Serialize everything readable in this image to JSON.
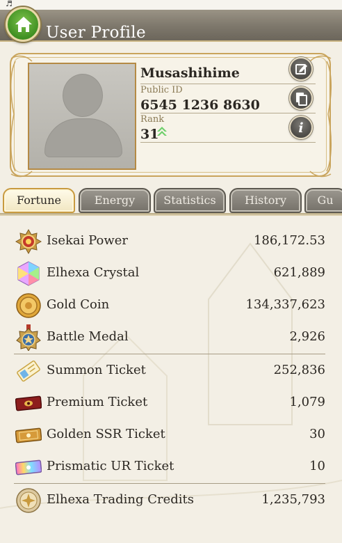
{
  "status_bar": {
    "glyph": "♬"
  },
  "header": {
    "title": "User Profile",
    "home_icon": "home-icon"
  },
  "profile": {
    "username": "Musashihime",
    "public_id_label": "Public ID",
    "public_id": "6545 1236 8630",
    "rank_label": "Rank",
    "rank": "31",
    "buttons": [
      "edit-icon",
      "copy-icon",
      "info-icon"
    ]
  },
  "tabs": [
    {
      "label": "Fortune",
      "active": true
    },
    {
      "label": "Energy",
      "active": false
    },
    {
      "label": "Statistics",
      "active": false
    },
    {
      "label": "History",
      "active": false
    },
    {
      "label": "Gu",
      "active": false
    }
  ],
  "fortune": [
    {
      "label": "Isekai Power",
      "value": "186,172.53",
      "icon": "isekai-power-icon"
    },
    {
      "label": "Elhexa Crystal",
      "value": "621,889",
      "icon": "elhexa-crystal-icon"
    },
    {
      "label": "Gold Coin",
      "value": "134,337,623",
      "icon": "gold-coin-icon"
    },
    {
      "label": "Battle Medal",
      "value": "2,926",
      "icon": "battle-medal-icon"
    },
    {
      "label": "Summon Ticket",
      "value": "252,836",
      "icon": "summon-ticket-icon"
    },
    {
      "label": "Premium Ticket",
      "value": "1,079",
      "icon": "premium-ticket-icon"
    },
    {
      "label": "Golden SSR Ticket",
      "value": "30",
      "icon": "golden-ssr-ticket-icon"
    },
    {
      "label": "Prismatic UR Ticket",
      "value": "10",
      "icon": "prismatic-ur-ticket-icon"
    },
    {
      "label": "Elhexa Trading Credits",
      "value": "1,235,793",
      "icon": "elhexa-trading-credits-icon"
    }
  ],
  "colors": {
    "header": "#7d776b",
    "home_button": "#4a9a2a",
    "card_gold": "#c9a45c",
    "tab_active": "#f1e6c2",
    "tab_inactive": "#85817a",
    "rank_arrow": "#6dcf6a"
  }
}
